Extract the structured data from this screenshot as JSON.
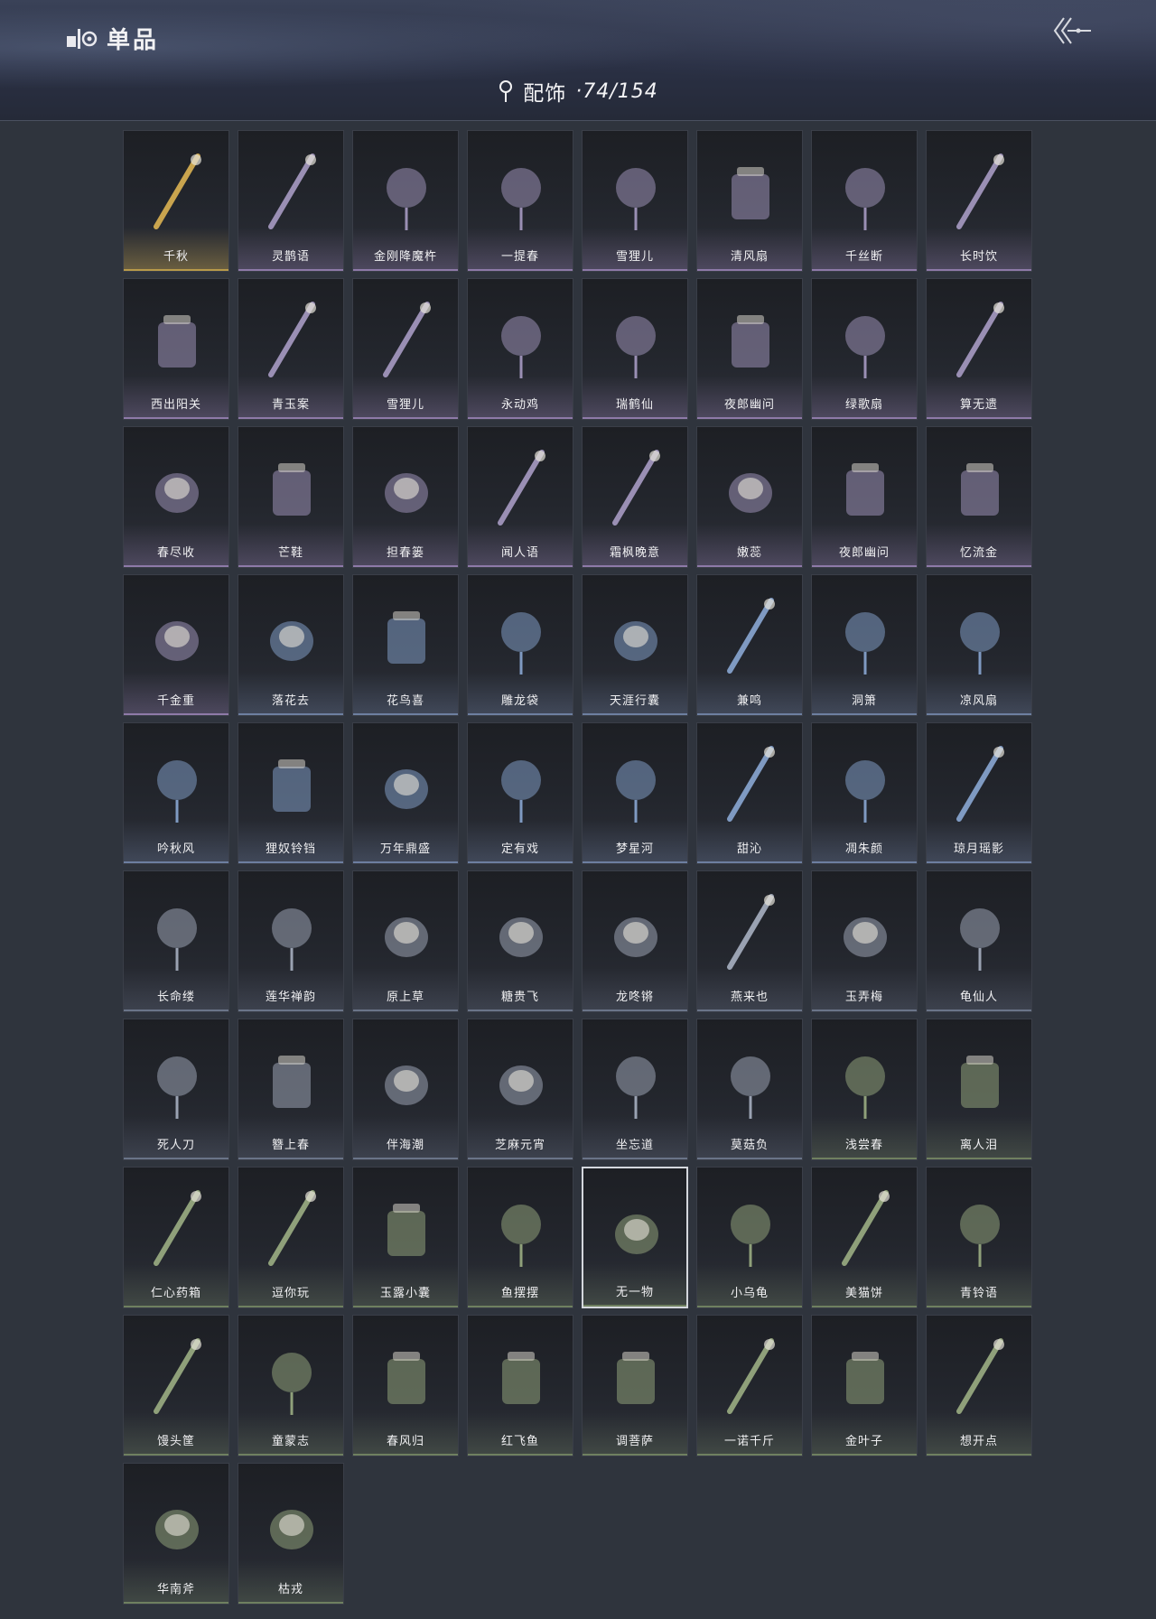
{
  "header": {
    "title": "单品",
    "category": "配饰",
    "count": "·74/154"
  },
  "colors": {
    "gold": "#b89a4a",
    "purple": "#8e7aa8",
    "blue": "#6d7fa0",
    "slate": "#6a7488",
    "green": "#6f8060"
  },
  "items": [
    {
      "name": "千秋",
      "tint": "gold",
      "icon": "net-icon"
    },
    {
      "name": "灵鹊语",
      "tint": "purple",
      "icon": "bird-icon"
    },
    {
      "name": "金刚降魔杵",
      "tint": "purple",
      "icon": "staff-icon"
    },
    {
      "name": "一提春",
      "tint": "purple",
      "icon": "flower-basket-icon"
    },
    {
      "name": "雪狸儿",
      "tint": "purple",
      "icon": "tail-icon"
    },
    {
      "name": "清风扇",
      "tint": "purple",
      "icon": "fan-icon"
    },
    {
      "name": "千丝断",
      "tint": "purple",
      "icon": "blade-icon"
    },
    {
      "name": "长时饮",
      "tint": "purple",
      "icon": "teapot-icon"
    },
    {
      "name": "西出阳关",
      "tint": "purple",
      "icon": "gourd-icon"
    },
    {
      "name": "青玉案",
      "tint": "purple",
      "icon": "scroll-icon"
    },
    {
      "name": "雪狸儿",
      "tint": "purple",
      "icon": "ears-icon"
    },
    {
      "name": "永动鸡",
      "tint": "purple",
      "icon": "rooster-icon"
    },
    {
      "name": "瑞鹤仙",
      "tint": "purple",
      "icon": "whisk-icon"
    },
    {
      "name": "夜郎幽问",
      "tint": "purple",
      "icon": "feather-icon"
    },
    {
      "name": "绿歌扇",
      "tint": "purple",
      "icon": "round-fan-icon"
    },
    {
      "name": "算无遗",
      "tint": "purple",
      "icon": "abacus-icon"
    },
    {
      "name": "春尽收",
      "tint": "purple",
      "icon": "basket-icon"
    },
    {
      "name": "芒鞋",
      "tint": "purple",
      "icon": "sandal-icon"
    },
    {
      "name": "担春篓",
      "tint": "purple",
      "icon": "bucket-icon"
    },
    {
      "name": "闻人语",
      "tint": "purple",
      "icon": "ears-icon"
    },
    {
      "name": "霜枫晚意",
      "tint": "purple",
      "icon": "maple-icon"
    },
    {
      "name": "嫩蕊",
      "tint": "purple",
      "icon": "daisy-icon"
    },
    {
      "name": "夜郎幽问",
      "tint": "purple",
      "icon": "crown-icon"
    },
    {
      "name": "忆流金",
      "tint": "purple",
      "icon": "hairpin-icon"
    },
    {
      "name": "千金重",
      "tint": "purple",
      "icon": "gold-bird-icon"
    },
    {
      "name": "落花去",
      "tint": "blue",
      "icon": "blue-flower-icon"
    },
    {
      "name": "花鸟喜",
      "tint": "blue",
      "icon": "kite-icon"
    },
    {
      "name": "雕龙袋",
      "tint": "blue",
      "icon": "cage-icon"
    },
    {
      "name": "天涯行囊",
      "tint": "blue",
      "icon": "bundle-icon"
    },
    {
      "name": "兼鸣",
      "tint": "blue",
      "icon": "shield-icon"
    },
    {
      "name": "洞箫",
      "tint": "blue",
      "icon": "flute-icon"
    },
    {
      "name": "凉风扇",
      "tint": "blue",
      "icon": "round-fan-icon"
    },
    {
      "name": "吟秋风",
      "tint": "blue",
      "icon": "leaf-fan-icon"
    },
    {
      "name": "狸奴铃铛",
      "tint": "blue",
      "icon": "bell-icon"
    },
    {
      "name": "万年鼎盛",
      "tint": "blue",
      "icon": "cauldron-icon"
    },
    {
      "name": "定有戏",
      "tint": "blue",
      "icon": "ornament-icon"
    },
    {
      "name": "梦星河",
      "tint": "blue",
      "icon": "boat-icon"
    },
    {
      "name": "甜沁",
      "tint": "blue",
      "icon": "candy-icon"
    },
    {
      "name": "凋朱颜",
      "tint": "blue",
      "icon": "pendant-icon"
    },
    {
      "name": "琼月瑶影",
      "tint": "blue",
      "icon": "moon-icon"
    },
    {
      "name": "长命缕",
      "tint": "slate",
      "icon": "tassel-icon"
    },
    {
      "name": "莲华禅韵",
      "tint": "slate",
      "icon": "gold-flower-icon"
    },
    {
      "name": "原上草",
      "tint": "slate",
      "icon": "lantern-icon"
    },
    {
      "name": "糖贵飞",
      "tint": "slate",
      "icon": "sugar-icon"
    },
    {
      "name": "龙咚锵",
      "tint": "slate",
      "icon": "drum-icon"
    },
    {
      "name": "燕来也",
      "tint": "slate",
      "icon": "swallow-icon"
    },
    {
      "name": "玉弄梅",
      "tint": "slate",
      "icon": "quiver-icon"
    },
    {
      "name": "龟仙人",
      "tint": "slate",
      "icon": "shell-icon"
    },
    {
      "name": "死人刀",
      "tint": "slate",
      "icon": "blade-icon"
    },
    {
      "name": "簪上春",
      "tint": "slate",
      "icon": "rose-icon"
    },
    {
      "name": "伴海潮",
      "tint": "slate",
      "icon": "starfish-icon"
    },
    {
      "name": "芝麻元宵",
      "tint": "slate",
      "icon": "panda-icon"
    },
    {
      "name": "坐忘道",
      "tint": "slate",
      "icon": "mask-icon"
    },
    {
      "name": "莫菇负",
      "tint": "slate",
      "icon": "mushroom-icon"
    },
    {
      "name": "浅尝春",
      "tint": "green",
      "icon": "fruit-icon"
    },
    {
      "name": "离人泪",
      "tint": "green",
      "icon": "jar-icon"
    },
    {
      "name": "仁心药箱",
      "tint": "green",
      "icon": "chest-icon"
    },
    {
      "name": "逗你玩",
      "tint": "green",
      "icon": "paper-lantern-icon"
    },
    {
      "name": "玉露小囊",
      "tint": "green",
      "icon": "pouch-icon"
    },
    {
      "name": "鱼摆摆",
      "tint": "green",
      "icon": "fish-icon"
    },
    {
      "name": "无一物",
      "tint": "green",
      "icon": "sack-icon",
      "selected": true
    },
    {
      "name": "小乌龟",
      "tint": "green",
      "icon": "turtle-icon"
    },
    {
      "name": "美猫饼",
      "tint": "green",
      "icon": "coin-icon"
    },
    {
      "name": "青铃语",
      "tint": "green",
      "icon": "wind-bell-icon"
    },
    {
      "name": "馒头筐",
      "tint": "green",
      "icon": "steamer-icon"
    },
    {
      "name": "童蒙志",
      "tint": "green",
      "icon": "banner-icon"
    },
    {
      "name": "春风归",
      "tint": "green",
      "icon": "kite-icon"
    },
    {
      "name": "红飞鱼",
      "tint": "green",
      "icon": "red-kite-icon"
    },
    {
      "name": "调菩萨",
      "tint": "green",
      "icon": "prayer-icon"
    },
    {
      "name": "一诺千斤",
      "tint": "green",
      "icon": "roast-icon"
    },
    {
      "name": "金叶子",
      "tint": "green",
      "icon": "gold-leaf-icon"
    },
    {
      "name": "想开点",
      "tint": "green",
      "icon": "knife-icon"
    },
    {
      "name": "华南斧",
      "tint": "green",
      "icon": "axe-icon"
    },
    {
      "name": "枯戎",
      "tint": "green",
      "icon": "branch-icon"
    }
  ]
}
